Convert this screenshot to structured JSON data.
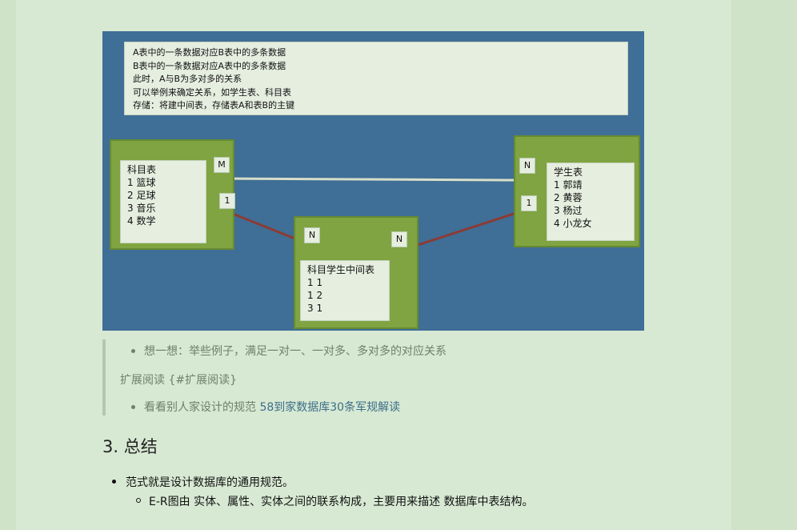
{
  "figure": {
    "note_lines": [
      "A表中的一条数据对应B表中的多条数据",
      "B表中的一条数据对应A表中的多条数据",
      "此时，A与B为多对多的关系",
      "可以举例来确定关系，如学生表、科目表",
      "存储：将建中间表，存储表A和表B的主键"
    ],
    "subject_table": {
      "title": "科目表",
      "rows": [
        "1 篮球",
        "2 足球",
        "3 音乐",
        "4 数学"
      ]
    },
    "student_table": {
      "title": "学生表",
      "rows": [
        "1 郭靖",
        "2 黄蓉",
        "3 杨过",
        "4 小龙女"
      ]
    },
    "middle_table": {
      "title": "科目学生中间表",
      "rows": [
        "1 1",
        "1 2",
        "3 1"
      ]
    },
    "tags": {
      "subject_m": "M",
      "subject_1": "1",
      "student_n": "N",
      "student_1": "1",
      "middle_left_n": "N",
      "middle_right_n": "N"
    },
    "colors": {
      "background": "#3f6e96",
      "table_green": "#7fa441",
      "relation_line": "#8c3b34",
      "mn_line": "#d7dfc9"
    }
  },
  "quote": {
    "item1": "想一想：举些例子，满足一对一、一对多、多对多的对应关系",
    "extended_reading": "扩展阅读 {#扩展阅读}",
    "item2_prefix": "看看别人家设计的规范",
    "item2_link": "58到家数据库30条军规解读"
  },
  "section": {
    "heading": "3. 总结",
    "bullet1": "范式就是设计数据库的通用规范。",
    "sub_bullet1": "E-R图由 实体、属性、实体之间的联系构成，主要用来描述 数据库中表结构。"
  }
}
